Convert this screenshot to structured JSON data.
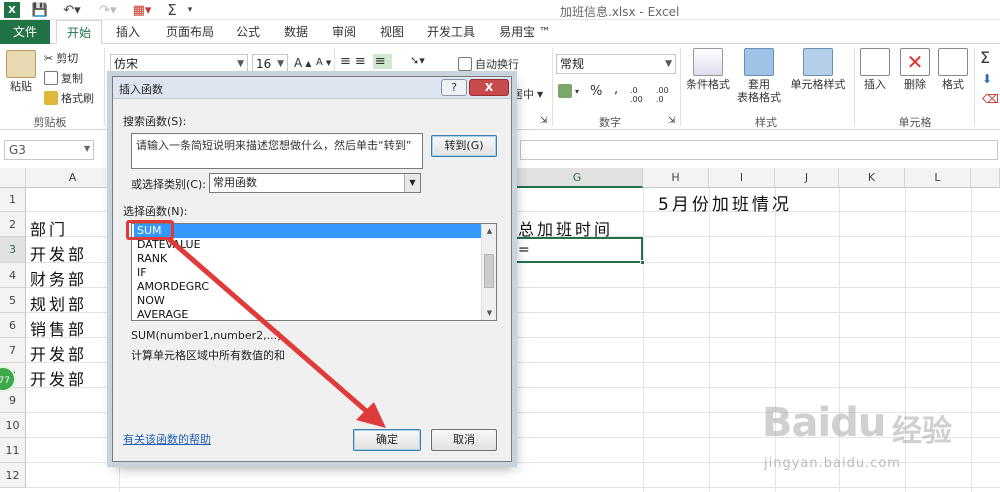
{
  "window": {
    "title": "加班信息.xlsx - Excel"
  },
  "ribbon_tabs": [
    "文件",
    "开始",
    "插入",
    "页面布局",
    "公式",
    "数据",
    "审阅",
    "视图",
    "开发工具",
    "易用宝 ™"
  ],
  "ribbon": {
    "clipboard": {
      "paste": "粘贴",
      "cut": "剪切",
      "copy": "复制",
      "format_painter": "格式刷",
      "label": "剪贴板"
    },
    "font": {
      "name": "仿宋",
      "size": "16",
      "grow": "A",
      "shrink": "A"
    },
    "alignment": {
      "wrap": "自动换行",
      "merge": "居中"
    },
    "number": {
      "format": "常规",
      "label": "数字",
      "currency_icon": "currency-icon",
      "percent": "%",
      "comma": ",",
      "inc_dec": ".0 .00",
      "dec_dec": ".00 .0"
    },
    "styles": {
      "conditional": "条件格式",
      "table_format_line1": "套用",
      "table_format_line2": "表格格式",
      "cell_styles": "单元格样式",
      "label": "样式"
    },
    "cells": {
      "insert": "插入",
      "delete": "删除",
      "format": "格式",
      "label": "单元格"
    }
  },
  "formula_bar": {
    "name_box": "G3"
  },
  "grid": {
    "columns": [
      "A",
      "G",
      "H",
      "I",
      "J",
      "K",
      "L"
    ],
    "rows": [
      "1",
      "2",
      "3",
      "4",
      "5",
      "6",
      "7",
      "8",
      "9",
      "10",
      "11",
      "12"
    ],
    "selected_column": "G",
    "selected_row": "3",
    "cells": {
      "title": "5月份加班情况",
      "a2": "部门",
      "g2": "总加班时间",
      "g3": "=",
      "a3": "开发部",
      "a4": "财务部",
      "a5": "规划部",
      "a6": "销售部",
      "a7": "开发部",
      "a8": "开发部"
    }
  },
  "dialog": {
    "title": "插入函数",
    "help_button": "?",
    "close_button": "X",
    "search_label": "搜索函数(S):",
    "search_value": "请输入一条简短说明来描述您想做什么，然后单击“转到”",
    "goto_button": "转到(G)",
    "category_label": "或选择类别(C):",
    "category_value": "常用函数",
    "select_label": "选择函数(N):",
    "functions": [
      "SUM",
      "DATEVALUE",
      "RANK",
      "IF",
      "AMORDEGRC",
      "NOW",
      "AVERAGE"
    ],
    "selected_function": "SUM",
    "signature": "SUM(number1,number2,...)",
    "description": "计算单元格区域中所有数值的和",
    "help_link": "有关该函数的帮助",
    "ok_button": "确定",
    "cancel_button": "取消"
  },
  "floating_badge": "77",
  "watermark": {
    "logo": "Baidu",
    "brand": "经验",
    "url": "jingyan.baidu.com"
  },
  "colors": {
    "excel_green": "#217346",
    "annotation_red": "#e03b3b",
    "selection_blue": "#3399ff"
  }
}
